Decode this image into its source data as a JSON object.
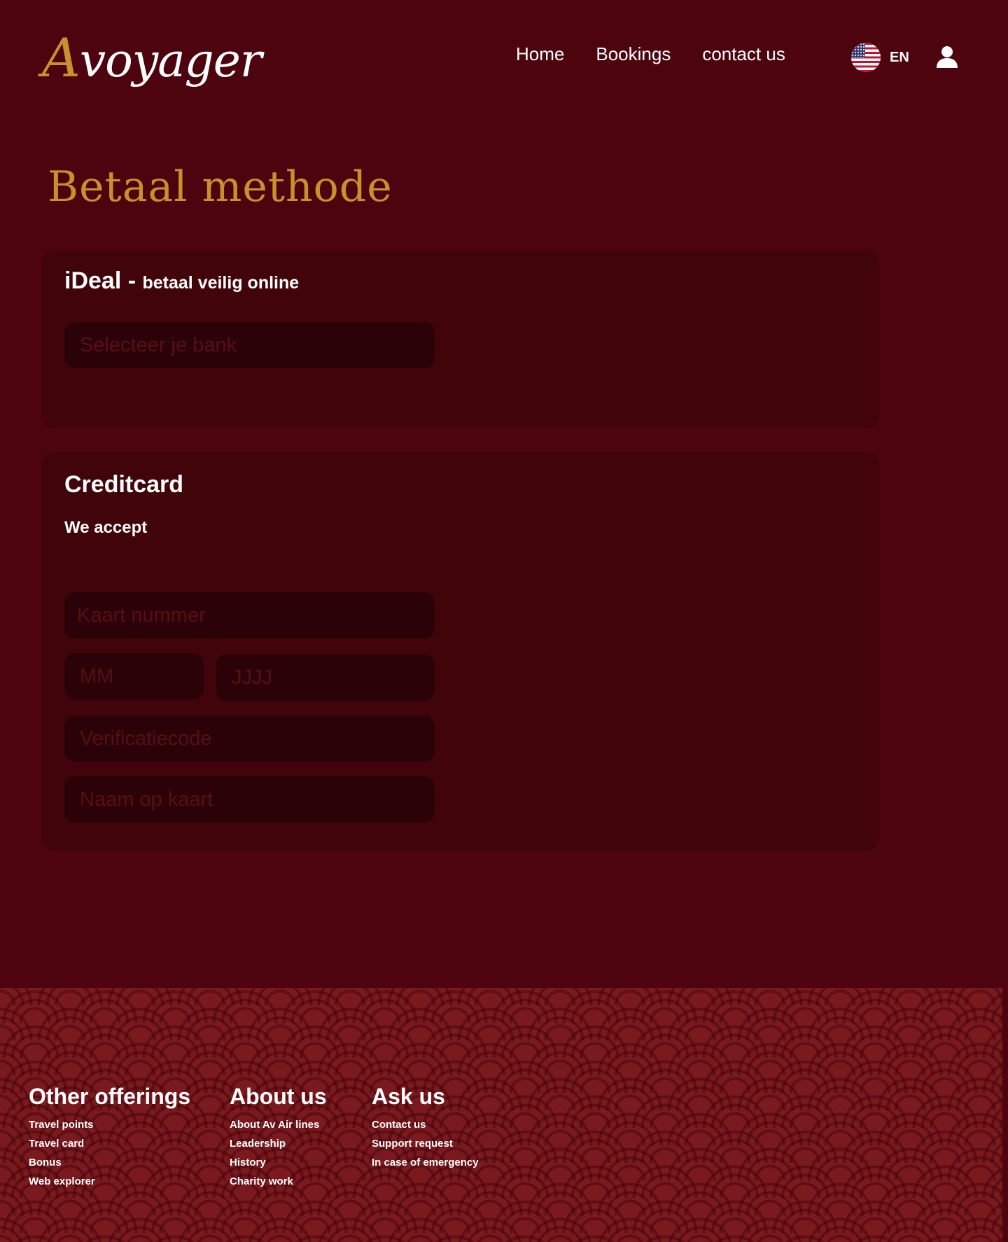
{
  "header": {
    "logo_initial": "A",
    "logo_rest": "voyager",
    "nav": [
      "Home",
      "Bookings",
      "contact us"
    ],
    "language": "EN",
    "flag_icon": "us-flag-icon",
    "user_icon": "user-icon"
  },
  "main": {
    "title": "Betaal methode",
    "ideal": {
      "title": "iDeal - ",
      "subtitle": "betaal veilig online",
      "bank_placeholder": "Selecteer je bank"
    },
    "creditcard": {
      "title": "Creditcard",
      "we_accept": "We accept",
      "card_number_placeholder": "Kaart nummer",
      "month_placeholder": "MM",
      "year_placeholder": "JJJJ",
      "cvc_placeholder": "Verificatiecode",
      "name_placeholder": "Naam op kaart"
    }
  },
  "footer": {
    "columns": [
      {
        "title": "Other offerings",
        "items": [
          "Travel points",
          "Travel card",
          "Bonus",
          "Web explorer"
        ]
      },
      {
        "title": "About us",
        "items": [
          "About Av Air lines",
          "Leadership",
          "History",
          "Charity work"
        ]
      },
      {
        "title": "Ask us",
        "items": [
          "Contact us",
          "Support request",
          "In case of emergency"
        ]
      }
    ]
  },
  "colors": {
    "background": "#4d040e",
    "card": "#42040b",
    "input": "#2a0208",
    "accent_gold": "#c9912c",
    "footer": "#7a1a1e"
  }
}
